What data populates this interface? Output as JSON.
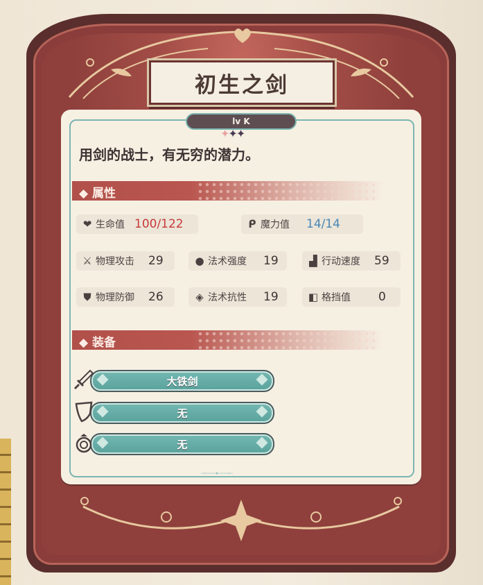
{
  "card": {
    "title": "初生之剑",
    "level": "lv K",
    "description": "用剑的战士，有无穷的潜力。"
  },
  "sections": {
    "attributes": "属性",
    "equipment": "装备"
  },
  "stats": {
    "hp": {
      "label": "生命值",
      "value": "100/122",
      "icon": "heart-icon"
    },
    "mp": {
      "label": "魔力值",
      "value": "14/14",
      "icon": "mana-icon"
    },
    "phys_atk": {
      "label": "物理攻击",
      "value": "29",
      "icon": "sword-icon"
    },
    "magic_power": {
      "label": "法术强度",
      "value": "19",
      "icon": "drop-icon"
    },
    "speed": {
      "label": "行动速度",
      "value": "59",
      "icon": "boot-icon"
    },
    "phys_def": {
      "label": "物理防御",
      "value": "26",
      "icon": "shield-icon"
    },
    "magic_res": {
      "label": "法术抗性",
      "value": "19",
      "icon": "diamond-icon"
    },
    "block": {
      "label": "格挡值",
      "value": "0",
      "icon": "block-icon"
    }
  },
  "equipment": [
    {
      "slot": "weapon",
      "icon": "sword-slot-icon",
      "name": "大铁剑"
    },
    {
      "slot": "armor",
      "icon": "shield-slot-icon",
      "name": "无"
    },
    {
      "slot": "accessory",
      "icon": "ring-slot-icon",
      "name": "无"
    }
  ],
  "colors": {
    "frame": "#8a3d3a",
    "panel": "#f6f0e3",
    "accent_teal": "#74b8b2",
    "hp_red": "#c73a3a",
    "mp_blue": "#4b87b5"
  }
}
